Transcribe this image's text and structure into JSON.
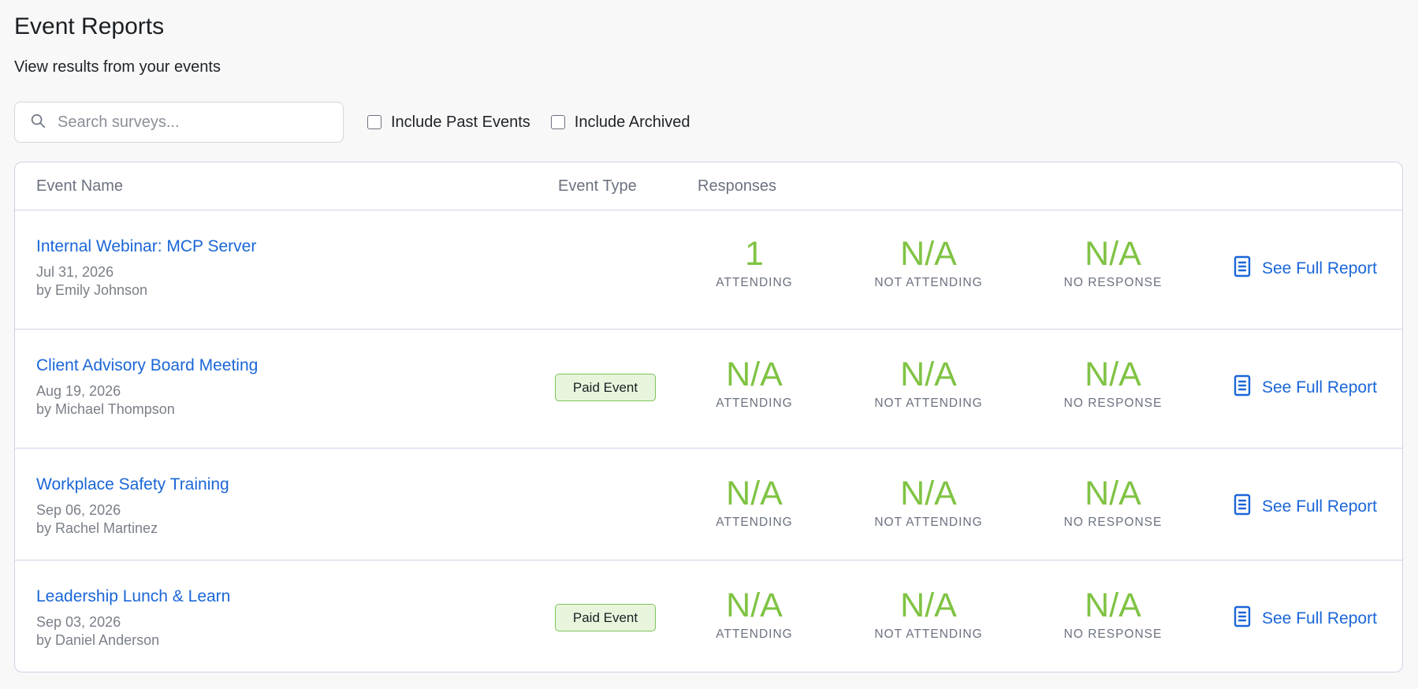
{
  "header": {
    "title": "Event Reports",
    "subtitle": "View results from your events"
  },
  "filters": {
    "search_placeholder": "Search surveys...",
    "include_past_label": "Include Past Events",
    "include_past_checked": false,
    "include_archived_label": "Include Archived",
    "include_archived_checked": false
  },
  "table": {
    "columns": {
      "event_name": "Event Name",
      "event_type": "Event Type",
      "responses": "Responses"
    },
    "stat_labels": {
      "attending": "ATTENDING",
      "not_attending": "NOT ATTENDING",
      "no_response": "NO RESPONSE"
    },
    "report_link_label": "See Full Report",
    "rows": [
      {
        "name": "Internal Webinar: MCP Server",
        "date": "Jul 31, 2026",
        "author": "by Emily Johnson",
        "event_type": "",
        "attending": "1",
        "not_attending": "N/A",
        "no_response": "N/A"
      },
      {
        "name": "Client Advisory Board Meeting",
        "date": "Aug 19, 2026",
        "author": "by Michael Thompson",
        "event_type": "Paid Event",
        "attending": "N/A",
        "not_attending": "N/A",
        "no_response": "N/A"
      },
      {
        "name": "Workplace Safety Training",
        "date": "Sep 06, 2026",
        "author": "by Rachel Martinez",
        "event_type": "",
        "attending": "N/A",
        "not_attending": "N/A",
        "no_response": "N/A"
      },
      {
        "name": "Leadership Lunch & Learn",
        "date": "Sep 03, 2026",
        "author": "by Daniel Anderson",
        "event_type": "Paid Event",
        "attending": "N/A",
        "not_attending": "N/A",
        "no_response": "N/A"
      }
    ]
  },
  "colors": {
    "link": "#1a66d8",
    "stat_value": "#80c344",
    "badge_bg": "#e8f5dc",
    "badge_border": "#7cc35a",
    "border": "#cfd3e4"
  },
  "icons": {
    "search": "search-icon",
    "report": "document-icon"
  }
}
